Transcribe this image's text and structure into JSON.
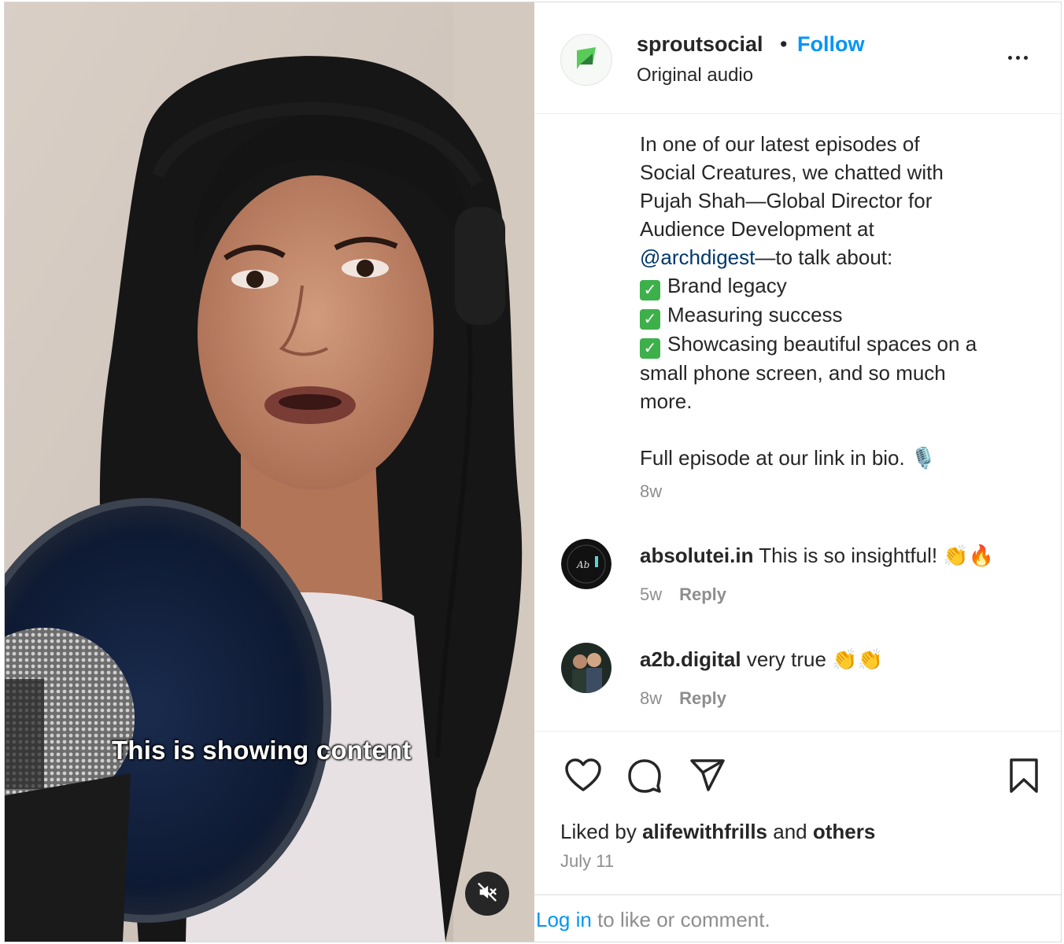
{
  "video": {
    "caption_overlay": "This is showing content",
    "mute_icon": "volume-muted-icon"
  },
  "post": {
    "username": "sproutsocial",
    "separator": "•",
    "follow_label": "Follow",
    "audio_label": "Original audio",
    "more_icon": "more-options-icon"
  },
  "caption": {
    "line1": "In one of our latest episodes of",
    "line2": "Social Creatures, we chatted with",
    "line3": "Pujah Shah—Global Director for",
    "line4": "Audience Development at",
    "mention": "@archdigest",
    "line5_rest": "—to talk about:",
    "bullet1": "Brand legacy",
    "bullet2": "Measuring success",
    "bullet3": "Showcasing beautiful spaces on a",
    "line9": "small phone screen, and so much",
    "line10": "more.",
    "line11": "Full episode at our link in bio. 🎙️",
    "time": "8w"
  },
  "comments": [
    {
      "username": "absolutei.in",
      "text": "This is so insightful! 👏🔥",
      "time": "5w",
      "reply_label": "Reply"
    },
    {
      "username": "a2b.digital",
      "text": "very true 👏👏",
      "time": "8w",
      "reply_label": "Reply"
    }
  ],
  "actions": {
    "like_icon": "heart-icon",
    "comment_icon": "comment-icon",
    "share_icon": "send-icon",
    "save_icon": "bookmark-icon"
  },
  "likes": {
    "prefix": "Liked by",
    "user": "alifewithfrills",
    "and": "and",
    "others": "others"
  },
  "date": "July 11",
  "login": {
    "link": "Log in",
    "rest": "to like or comment."
  },
  "colors": {
    "accent": "#0095f6",
    "mention": "#00376b",
    "muted": "#8e8e8e",
    "text": "#262626",
    "brand_green": "#59cb59"
  }
}
